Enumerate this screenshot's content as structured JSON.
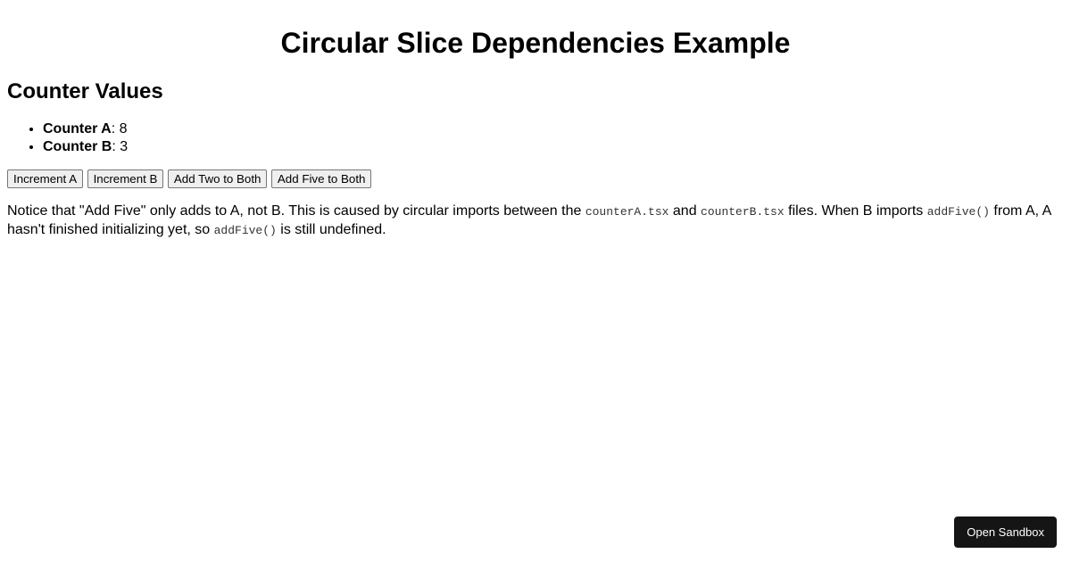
{
  "title": "Circular Slice Dependencies Example",
  "section_heading": "Counter Values",
  "counters": {
    "a": {
      "label": "Counter A",
      "value": "8"
    },
    "b": {
      "label": "Counter B",
      "value": "3"
    }
  },
  "buttons": {
    "increment_a": "Increment A",
    "increment_b": "Increment B",
    "add_two": "Add Two to Both",
    "add_five": "Add Five to Both"
  },
  "description": {
    "part1": "Notice that \"Add Five\" only adds to A, not B. This is caused by circular imports between the ",
    "code1": "counterA.tsx",
    "part2": " and ",
    "code2": "counterB.tsx",
    "part3": " files. When B imports ",
    "code3": "addFive()",
    "part4": " from A, A hasn't finished initializing yet, so ",
    "code4": "addFive()",
    "part5": " is still undefined."
  },
  "open_sandbox": "Open Sandbox"
}
